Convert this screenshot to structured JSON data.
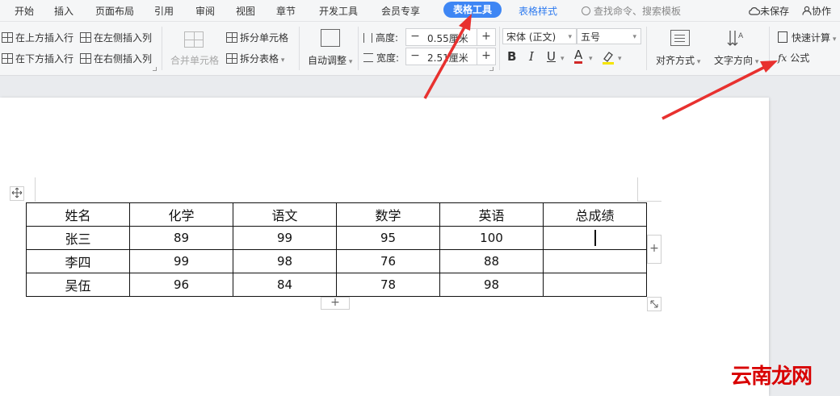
{
  "menu": {
    "items": [
      "开始",
      "插入",
      "页面布局",
      "引用",
      "审阅",
      "视图",
      "章节",
      "开发工具",
      "会员专享"
    ],
    "active_tab": "表格工具",
    "style_tab": "表格样式",
    "search_placeholder": "查找命令、搜索模板",
    "save_status": "未保存",
    "collab": "协作"
  },
  "ribbon": {
    "insert_above": "在上方插入行",
    "insert_below": "在下方插入行",
    "insert_left": "在左侧插入列",
    "insert_right": "在右侧插入列",
    "merge_cells": "合并单元格",
    "split_cells": "拆分单元格",
    "split_table": "拆分表格",
    "auto_fit": "自动调整",
    "height_label": "高度:",
    "height_value": "0.55厘米",
    "width_label": "宽度:",
    "width_value": "2.51厘米",
    "minus": "−",
    "plus": "+",
    "font_name": "宋体 (正文)",
    "font_size": "五号",
    "bold": "B",
    "italic": "I",
    "underline": "U",
    "font_color": "A",
    "align": "对齐方式",
    "text_direction": "文字方向",
    "quick_calc": "快速计算",
    "formula": "公式",
    "formula_icon": "fx"
  },
  "table": {
    "headers": [
      "姓名",
      "化学",
      "语文",
      "数学",
      "英语",
      "总成绩"
    ],
    "rows": [
      [
        "张三",
        "89",
        "99",
        "95",
        "100",
        ""
      ],
      [
        "李四",
        "99",
        "98",
        "76",
        "88",
        ""
      ],
      [
        "吴伍",
        "96",
        "84",
        "78",
        "98",
        ""
      ]
    ]
  },
  "watermark": "云南龙网",
  "colors": {
    "accent": "#3e86f4",
    "tab_blue": "#2f7bef",
    "arrow_red": "#e8312f",
    "font_color_bar": "#d12727",
    "highlight_bar": "#f5e400"
  }
}
